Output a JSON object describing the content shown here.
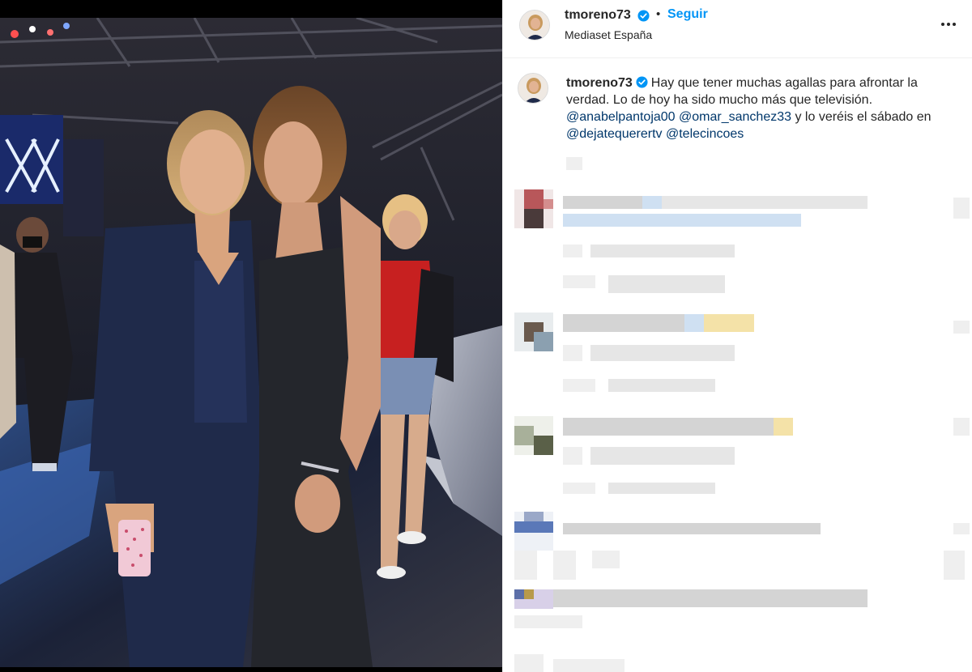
{
  "post": {
    "photo_alt": "Dos mujeres posando en un plató de televisión"
  },
  "header": {
    "username": "tmoreno73",
    "separator": "•",
    "follow_label": "Seguir",
    "location": "Mediaset España"
  },
  "caption": {
    "username": "tmoreno73",
    "text_part1": "Hay que tener muchas agallas para afrontar la verdad. Lo de hoy ha sido mucho más que televisión.",
    "mention1": "@anabelpantoja00",
    "mention2": "@omar_sanchez33",
    "text_part2": "y lo veréis el sábado en",
    "mention3": "@dejatequerertv",
    "mention4": "@telecincoes"
  },
  "icons": {
    "verified": "verified-badge-icon",
    "more": "more-options-icon"
  },
  "colors": {
    "accent": "#0095f6",
    "mention": "#00376b",
    "verified": "#0095f6"
  }
}
